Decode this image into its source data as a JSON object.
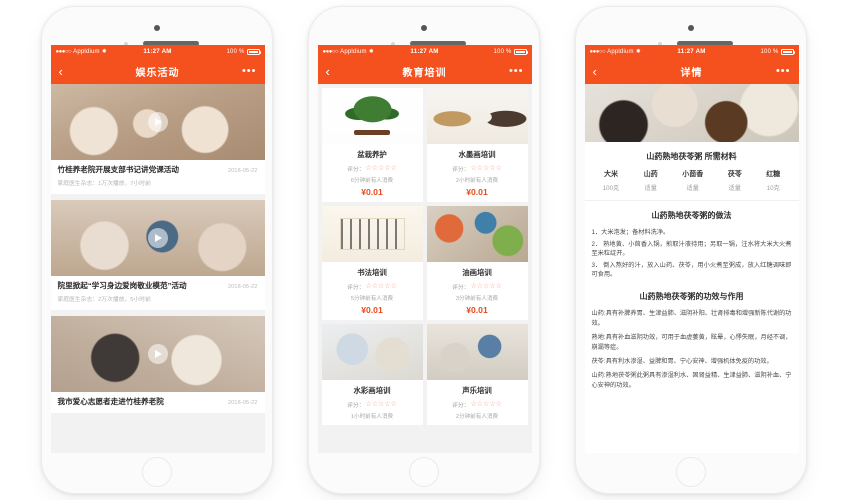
{
  "status_bar": {
    "signal_dots": "●●●○○",
    "carrier": "Appldium",
    "wifi_icon": "wifi-icon",
    "time": "11:27 AM",
    "battery_text": "100 %"
  },
  "phones": [
    {
      "nav": {
        "back_icon": "chevron-left-icon",
        "title": "娱乐活动",
        "more_icon": "ellipsis-icon"
      },
      "news": [
        {
          "image": "elderly-people-playing-photo",
          "title": "竹桂养老院开展支部书记讲党课活动",
          "date": "2018-05-22",
          "sub": "家庭医生杂志：1万次播放，7小时前",
          "play_icon": "play-icon"
        },
        {
          "image": "caregiver-with-elderly-photo",
          "title": "院里掀起“学习身边爱岗敬业模范”活动",
          "date": "2018-05-22",
          "sub": "家庭医生杂志：2万次播放，5小时前",
          "play_icon": "play-icon"
        },
        {
          "image": "volunteer-visiting-elderly-photo",
          "title": "我市爱心志愿者走进竹桂养老院",
          "date": "2018-05-22",
          "sub": "",
          "play_icon": "play-icon"
        }
      ]
    },
    {
      "nav": {
        "back_icon": "chevron-left-icon",
        "title": "教育培训",
        "more_icon": "ellipsis-icon"
      },
      "rating_label": "评分：",
      "stars": "☆☆☆☆☆",
      "courses": [
        {
          "image": "bonsai-tree-photo",
          "name": "盆栽养护",
          "sold": "6分钟前有人消费",
          "price": "¥0.01"
        },
        {
          "image": "ink-painting-horses-photo",
          "name": "水墨画培训",
          "sold": "2小时前有人消费",
          "price": "¥0.01"
        },
        {
          "image": "calligraphy-class-photo",
          "name": "书法培训",
          "sold": "5分钟前有人消费",
          "price": "¥0.01"
        },
        {
          "image": "oil-painting-photo",
          "name": "油画培训",
          "sold": "3分钟前有人消费",
          "price": "¥0.01"
        },
        {
          "image": "watercolor-class-photo",
          "name": "水彩画培训",
          "sold": "1小时前有人消费",
          "price": "¥0.01"
        },
        {
          "image": "vocal-music-class-photo",
          "name": "声乐培训",
          "sold": "2分钟前有人消费",
          "price": "¥0.01"
        }
      ]
    },
    {
      "nav": {
        "back_icon": "chevron-left-icon",
        "title": "详情",
        "more_icon": "ellipsis-icon"
      },
      "hero_image": "congee-ingredients-photo",
      "ingredients_title": "山药熟地茯苓粥 所需材料",
      "ingredients": [
        {
          "name": "大米",
          "qty": "100克"
        },
        {
          "name": "山药",
          "qty": "适量"
        },
        {
          "name": "小茴香",
          "qty": "适量"
        },
        {
          "name": "茯苓",
          "qty": "适量"
        },
        {
          "name": "红糖",
          "qty": "10克"
        }
      ],
      "method_title": "山药熟地茯苓粥的做法",
      "steps": [
        "1．大米泡发；备材料洗净。",
        "2． 熟地黄、小茴香入锅，煎取汁液待用；另取一锅，注水将大米大火煮至米粒绽开。",
        "3． 倒入熬好的汁，放入山药、茯苓，用小火煮至粥成，放入红糖调味即可食用。"
      ],
      "effect_title": "山药熟地茯苓粥的功效与作用",
      "paragraphs": [
        "山药:具有补脾养胃、生津益肺、滋阴补阳、壮肾排毒和增强新陈代谢的功效。",
        "熟地:具有补血滋阴功效，可用于血虚萎黄，眩晕，心悸失眠，月经不调，崩漏等症。",
        "茯苓:具有利水渗湿、益脾和胃、宁心安神、增强机体免疫的功效。",
        "山药:熟地茯苓粥此粥具有渗湿利水、固肾益精、生津益肺、滋阴补血、宁心安神的功效。"
      ]
    }
  ],
  "colors": {
    "brand": "#f4511e",
    "price": "#e64b1e",
    "star": "#f4a188"
  }
}
